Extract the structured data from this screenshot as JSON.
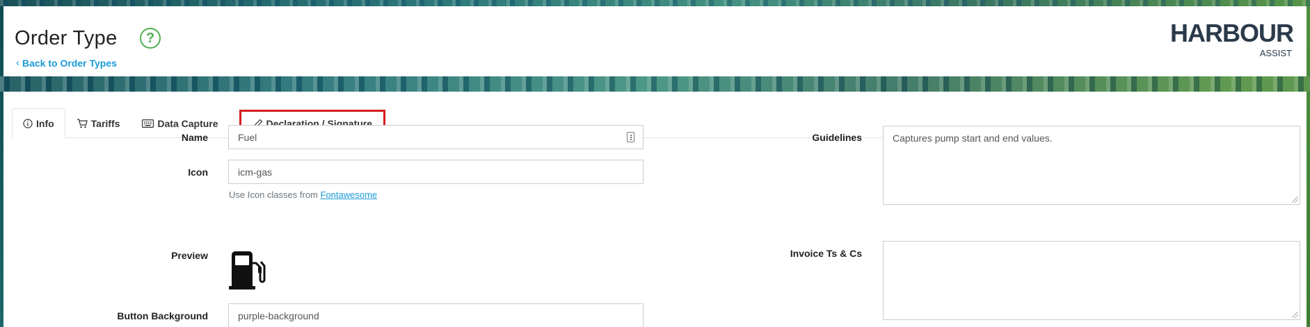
{
  "header": {
    "title": "Order Type",
    "help_glyph": "?",
    "back_link": "Back to Order Types",
    "logo": {
      "main": "HARBOUR",
      "sub": "ASSIST"
    }
  },
  "tabs": [
    {
      "label": "Info",
      "icon": "info-circle-icon",
      "active": true
    },
    {
      "label": "Tariffs",
      "icon": "cart-icon",
      "active": false
    },
    {
      "label": "Data Capture",
      "icon": "keyboard-icon",
      "active": false
    },
    {
      "label": "Declaration / Signature",
      "icon": "pen-icon",
      "active": false,
      "highlighted": true
    }
  ],
  "form": {
    "name": {
      "label": "Name",
      "value": "Fuel"
    },
    "icon": {
      "label": "Icon",
      "value": "icm-gas",
      "hint_prefix": "Use Icon classes from",
      "hint_link": "Fontawesome"
    },
    "preview": {
      "label": "Preview",
      "icon": "gas-pump-icon"
    },
    "button_background": {
      "label": "Button Background",
      "value": "purple-background"
    },
    "guidelines": {
      "label": "Guidelines",
      "value": "Captures pump start and end values."
    },
    "invoice_ts_cs": {
      "label": "Invoice Ts & Cs",
      "value": ""
    }
  },
  "colors": {
    "accent": "#1a9bd7",
    "help": "#4caf50",
    "highlight": "#d51c1c"
  }
}
